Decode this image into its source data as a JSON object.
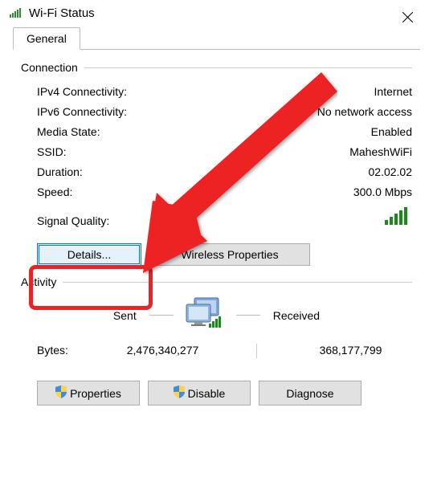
{
  "window": {
    "title": "Wi-Fi Status"
  },
  "tabs": {
    "general": "General"
  },
  "groups": {
    "connection_label": "Connection",
    "activity_label": "Activity"
  },
  "connection": {
    "ipv4_label": "IPv4 Connectivity:",
    "ipv4_value": "Internet",
    "ipv6_label": "IPv6 Connectivity:",
    "ipv6_value": "No network access",
    "media_label": "Media State:",
    "media_value": "Enabled",
    "ssid_label": "SSID:",
    "ssid_value": "MaheshWiFi",
    "duration_label": "Duration:",
    "duration_value": "02.02.02",
    "speed_label": "Speed:",
    "speed_value": "300.0 Mbps",
    "signal_label": "Signal Quality:"
  },
  "buttons": {
    "details": "Details...",
    "wireless_properties": "Wireless Properties",
    "properties": "Properties",
    "disable": "Disable",
    "diagnose": "Diagnose"
  },
  "activity": {
    "sent_label": "Sent",
    "received_label": "Received",
    "bytes_label": "Bytes:",
    "bytes_sent": "2,476,340,277",
    "bytes_received": "368,177,799"
  },
  "annotation": {
    "highlight_target": "details-button",
    "arrow_color": "#ed2224"
  }
}
